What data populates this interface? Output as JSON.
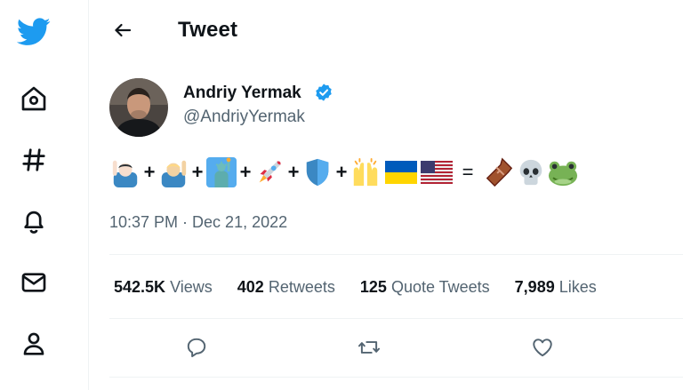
{
  "colors": {
    "brand": "#1d9bf0",
    "text": "#0f1419",
    "muted": "#536471",
    "divider": "#eff3f4"
  },
  "sidebar": {
    "items": [
      {
        "icon": "twitter-logo-icon"
      },
      {
        "icon": "home-icon"
      },
      {
        "icon": "hashtag-explore-icon"
      },
      {
        "icon": "bell-notifications-icon"
      },
      {
        "icon": "envelope-messages-icon"
      },
      {
        "icon": "person-profile-icon"
      }
    ]
  },
  "header": {
    "title": "Tweet",
    "back_icon": "back-arrow-icon"
  },
  "tweet": {
    "author": {
      "name": "Andriy Yermak",
      "handle": "@AndriyYermak",
      "verified": true
    },
    "emoji_text": [
      "🙋🏻‍♂️",
      "+",
      "🙋🏼‍♂️",
      "+",
      "🗽",
      "+",
      "🚀",
      "+",
      "🛡️",
      "+",
      "🙌",
      "🇺🇦",
      "🇺🇸",
      "=",
      "⚰️",
      "💀",
      "🐸"
    ],
    "timestamp": "10:37 PM · Dec 21, 2022",
    "stats": {
      "views": {
        "value": "542.5K",
        "label": "Views"
      },
      "retweets": {
        "value": "402",
        "label": "Retweets"
      },
      "quotes": {
        "value": "125",
        "label": "Quote Tweets"
      },
      "likes": {
        "value": "7,989",
        "label": "Likes"
      }
    },
    "actions": [
      "reply-icon",
      "retweet-icon",
      "like-heart-icon"
    ]
  }
}
